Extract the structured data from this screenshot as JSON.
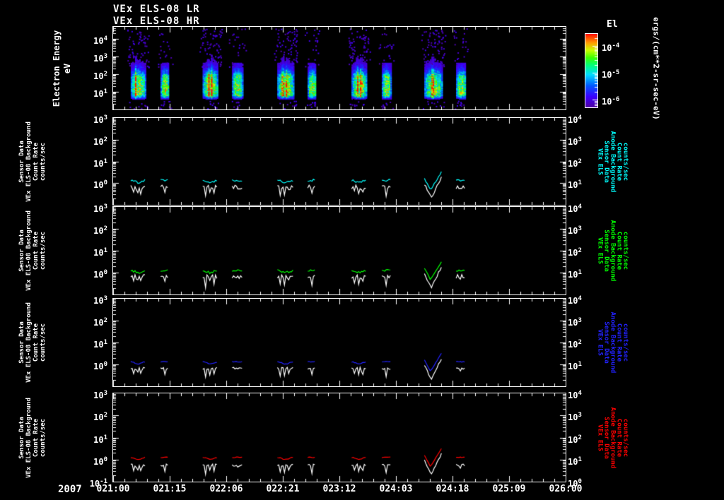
{
  "header": {
    "title_lines": [
      "VEx ELS-08 LR",
      "VEx ELS-08 HR"
    ]
  },
  "colors": {
    "background": "#000000",
    "foreground": "#ffffff",
    "panel2_accent": "#00ffff",
    "panel3_accent": "#00ff00",
    "panel4_accent": "#2222ff",
    "panel5_accent": "#ff0000"
  },
  "x_axis": {
    "year": "2007",
    "tick_labels": [
      "021:00",
      "021:15",
      "022:06",
      "022:21",
      "023:12",
      "024:03",
      "024:18",
      "025:09",
      "026:00"
    ]
  },
  "spectrogram_panel": {
    "ylabel_lines": [
      "Electron Energy",
      "eV"
    ],
    "ytick_exponents": [
      4,
      3,
      2,
      1
    ],
    "colorbar": {
      "title": "El",
      "tick_exponents": [
        -4,
        -5,
        -6
      ],
      "unit_label": "ergs/(cm**2-sr-sec-eV)"
    }
  },
  "line_panels": [
    {
      "accent_key": "panel2_accent",
      "left_label_lines": [
        "Sensor Data",
        "VEx ELS-08 Background",
        "Count Rate",
        "counts/sec"
      ],
      "right_label_lines": [
        "VEx ELS",
        "Sensor Data",
        "Anode Background",
        "Count Rate",
        "counts/sec"
      ],
      "left_tick_exponents": [
        3,
        2,
        1,
        0
      ],
      "right_tick_exponents": [
        4,
        3,
        2,
        1
      ]
    },
    {
      "accent_key": "panel3_accent",
      "left_label_lines": [
        "Sensor Data",
        "VEx ELS-08 Background",
        "Count Rate",
        "counts/sec"
      ],
      "right_label_lines": [
        "VEx ELS",
        "Sensor Data",
        "Anode Background",
        "Count Rate",
        "counts/sec"
      ],
      "left_tick_exponents": [
        3,
        2,
        1,
        0
      ],
      "right_tick_exponents": [
        4,
        3,
        2,
        1
      ]
    },
    {
      "accent_key": "panel4_accent",
      "left_label_lines": [
        "Sensor Data",
        "VEx ELS-08 Background",
        "Count Rate",
        "counts/sec"
      ],
      "right_label_lines": [
        "VEx ELS",
        "Sensor Data",
        "Anode Background",
        "Count Rate",
        "counts/sec"
      ],
      "left_tick_exponents": [
        3,
        2,
        1,
        0
      ],
      "right_tick_exponents": [
        4,
        3,
        2,
        1
      ]
    },
    {
      "accent_key": "panel5_accent",
      "left_label_lines": [
        "Sensor Data",
        "VEx ELS-08 Background",
        "Count Rate",
        "counts/sec"
      ],
      "right_label_lines": [
        "VEx ELS",
        "Sensor Data",
        "Anode Background",
        "Count Rate",
        "counts/sec"
      ],
      "left_tick_exponents": [
        3,
        2,
        1,
        0,
        -1
      ],
      "right_tick_exponents": [
        4,
        3,
        2,
        1,
        0
      ]
    }
  ],
  "chart_data": {
    "type": "heatmap",
    "title_lines": [
      "VEx ELS-08 LR",
      "VEx ELS-08 HR"
    ],
    "x_axis": {
      "year": "2007",
      "tick_labels": [
        "021:00",
        "021:15",
        "022:06",
        "022:21",
        "023:12",
        "024:03",
        "024:18",
        "025:09",
        "026:00"
      ]
    },
    "spectrogram": {
      "ylabel": "Electron Energy eV",
      "ytick_values_ev": [
        10000,
        1000,
        100,
        10
      ],
      "y_range_ev": [
        1,
        47000
      ],
      "colorbar_title": "El",
      "colorbar_tick_values": [
        0.0001,
        1e-05,
        1e-06
      ],
      "colorbar_units": "ergs/(cm**2-sr-sec-eV)",
      "energy_core_range_ev": [
        5,
        300
      ],
      "bursts": [
        {
          "t_start": 0.039,
          "t_end": 0.071,
          "intensity": "high",
          "streaks": [
            0.3
          ]
        },
        {
          "t_start": 0.105,
          "t_end": 0.123,
          "intensity": "medium",
          "streaks": []
        },
        {
          "t_start": 0.198,
          "t_end": 0.232,
          "intensity": "high",
          "streaks": [
            0.35,
            0.55
          ]
        },
        {
          "t_start": 0.263,
          "t_end": 0.285,
          "intensity": "medium",
          "streaks": []
        },
        {
          "t_start": 0.363,
          "t_end": 0.399,
          "intensity": "high",
          "streaks": [
            0.3,
            0.55
          ]
        },
        {
          "t_start": 0.43,
          "t_end": 0.448,
          "intensity": "medium",
          "streaks": []
        },
        {
          "t_start": 0.527,
          "t_end": 0.56,
          "intensity": "high",
          "streaks": [
            0.35,
            0.6
          ]
        },
        {
          "t_start": 0.594,
          "t_end": 0.613,
          "intensity": "medium",
          "streaks": []
        },
        {
          "t_start": 0.688,
          "t_end": 0.726,
          "intensity": "high",
          "streaks": [
            0.45
          ]
        },
        {
          "t_start": 0.758,
          "t_end": 0.779,
          "intensity": "medium",
          "streaks": []
        }
      ]
    },
    "special_segment_index": 8,
    "line_y_range": [
      0.1,
      1000
    ],
    "line_right_y_range": [
      1,
      10000
    ],
    "line_series": [
      {
        "name": "ELS-08 anode background (cyan)",
        "colored_level_log10": 0.13,
        "white_level_log10": -0.18,
        "smooth": false
      },
      {
        "name": "ELS-08 anode background (green)",
        "colored_level_log10": 0.1,
        "white_level_log10": -0.18,
        "smooth": false
      },
      {
        "name": "ELS-08 anode background (blue)",
        "colored_level_log10": 0.12,
        "white_level_log10": -0.18,
        "smooth": true
      },
      {
        "name": "ELS-08 anode background (red)",
        "colored_level_log10": 0.1,
        "white_level_log10": -0.25,
        "smooth": true
      }
    ]
  }
}
